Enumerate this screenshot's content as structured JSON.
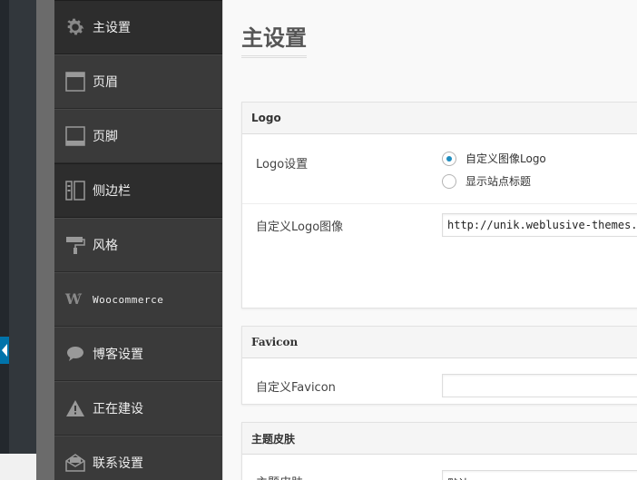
{
  "sidebar": {
    "items": [
      {
        "label": "主设置",
        "icon": "gear-icon"
      },
      {
        "label": "页眉",
        "icon": "header-layout-icon"
      },
      {
        "label": "页脚",
        "icon": "footer-layout-icon"
      },
      {
        "label": "侧边栏",
        "icon": "sidebar-layout-icon"
      },
      {
        "label": "风格",
        "icon": "paint-roller-icon"
      },
      {
        "label": "Woocommerce",
        "icon": "woocommerce-icon"
      },
      {
        "label": "博客设置",
        "icon": "speech-bubble-icon"
      },
      {
        "label": "正在建设",
        "icon": "warning-icon"
      },
      {
        "label": "联系设置",
        "icon": "envelope-icon"
      }
    ]
  },
  "main": {
    "title": "主设置",
    "logo_section": {
      "heading": "Logo",
      "logo_setting_label": "Logo设置",
      "options": [
        "自定义图像Logo",
        "显示站点标题"
      ],
      "selected": "自定义图像Logo",
      "custom_logo_label": "自定义Logo图像",
      "custom_logo_value": "http://unik.weblusive-themes.com/wp-content/uploads/logo.png"
    },
    "favicon_section": {
      "heading": "Favicon",
      "custom_favicon_label": "自定义Favicon",
      "custom_favicon_value": ""
    },
    "skin_section": {
      "heading": "主题皮肤",
      "skin_label": "主题皮肤",
      "skin_value": "默认"
    }
  },
  "colors": {
    "accent": "#1e8cbe",
    "sidebar_bg": "#3a3a3a",
    "sidebar_active": "#2d2d2d",
    "admin_bar": "#23282d"
  }
}
